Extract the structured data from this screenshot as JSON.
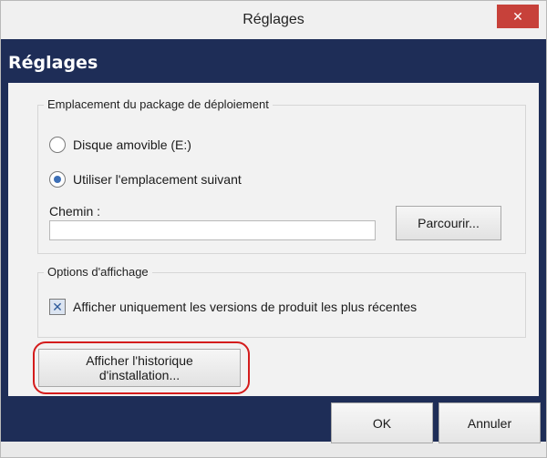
{
  "window": {
    "title": "Réglages",
    "close_label": "✕"
  },
  "header": {
    "title": "Réglages"
  },
  "deployment": {
    "legend": "Emplacement du package de déploiement",
    "option_removable": "Disque amovible (E:)",
    "option_removable_selected": false,
    "option_custom": "Utiliser l'emplacement suivant",
    "option_custom_selected": true,
    "path_label": "Chemin :",
    "path_value": "",
    "browse_label": "Parcourir..."
  },
  "display": {
    "legend": "Options d'affichage",
    "latest_only_label": "Afficher uniquement les versions de produit les plus récentes",
    "latest_only_checked": true,
    "checkbox_glyph": "✕"
  },
  "history_button": {
    "line1": "Afficher l'historique",
    "line2": "d'installation..."
  },
  "footer": {
    "ok_label": "OK",
    "cancel_label": "Annuler"
  },
  "colors": {
    "header_blue": "#1e2d57",
    "close_red": "#c7413a",
    "highlight_red": "#d41c1c",
    "radio_accent": "#3d6fb6"
  }
}
